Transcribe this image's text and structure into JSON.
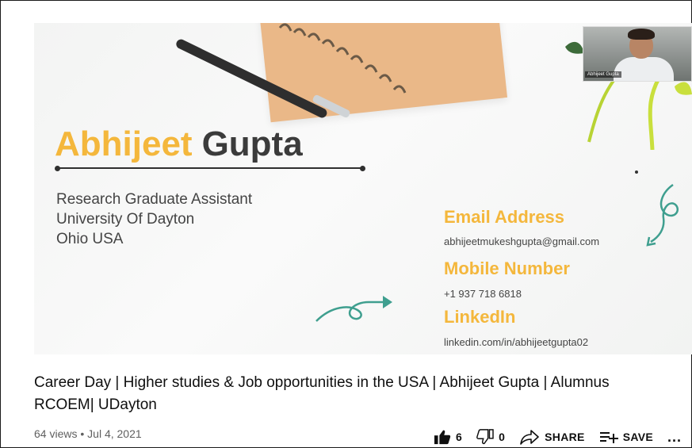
{
  "slide": {
    "name_first": "Abhijeet",
    "name_last": "Gupta",
    "role_lines": [
      "Research Graduate Assistant",
      "University Of Dayton",
      "Ohio USA"
    ],
    "contact": {
      "email_heading": "Email Address",
      "email_value": "abhijeetmukeshgupta@gmail.com",
      "mobile_heading": "Mobile Number",
      "mobile_value": "+1 937 718 6818",
      "linkedin_heading": "LinkedIn",
      "linkedin_value": "linkedin.com/in/abhijeetgupta02"
    },
    "webcam_label": "Abhijeet Gupta",
    "colors": {
      "accent": "#f4b73c",
      "dark": "#3b3b3b",
      "arrow": "#3f9f8f"
    }
  },
  "video_info": {
    "title": "Career Day | Higher studies & Job opportunities in the USA | Abhijeet Gupta | Alumnus RCOEM| UDayton",
    "views": "64 views",
    "separator": "•",
    "date": "Jul 4, 2021"
  },
  "actions": {
    "like_count": "6",
    "dislike_count": "0",
    "share_label": "SHARE",
    "save_label": "SAVE",
    "more_label": "..."
  },
  "icons": [
    "thumbs-up-icon",
    "thumbs-down-icon",
    "share-icon",
    "playlist-add-icon",
    "more-icon",
    "arrow-doodle-icon"
  ]
}
